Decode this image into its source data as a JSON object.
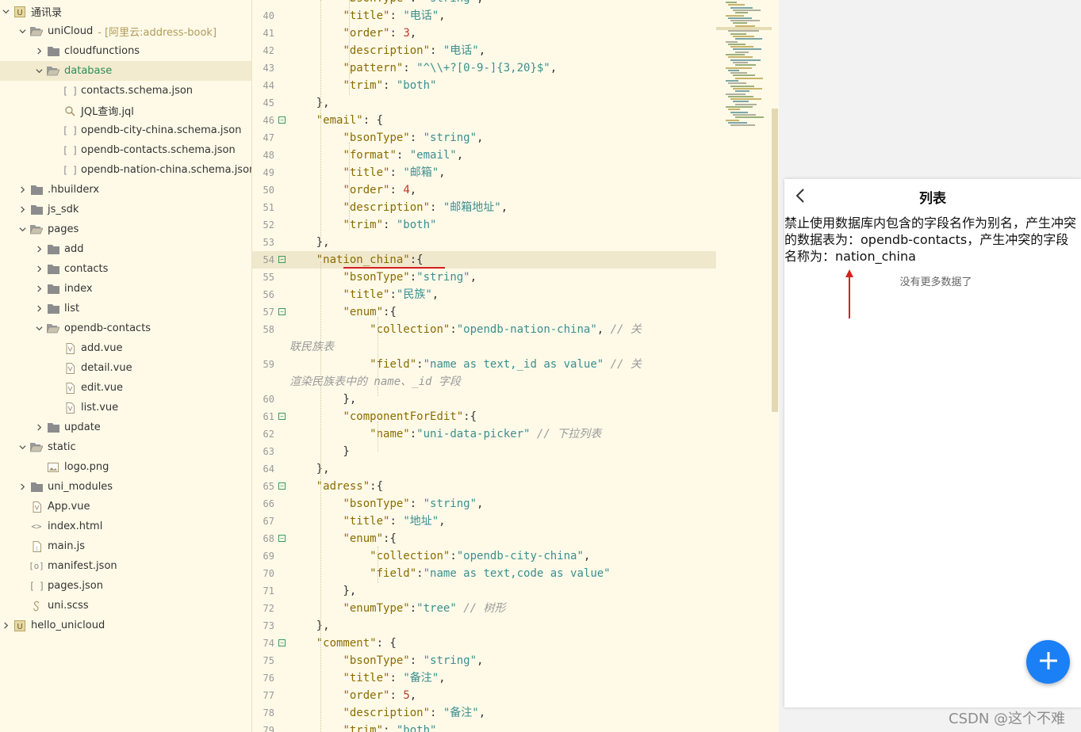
{
  "sidebar": {
    "items": [
      {
        "label": "通讯录",
        "suffix": "",
        "icon": "project-icon",
        "chev": "down",
        "indent": 0
      },
      {
        "label": "uniCloud",
        "suffix": "- [阿里云:address-book]",
        "icon": "folder-open-icon",
        "chev": "down",
        "indent": 1
      },
      {
        "label": "cloudfunctions",
        "suffix": "",
        "icon": "folder-closed-icon",
        "chev": "right",
        "indent": 2
      },
      {
        "label": "database",
        "suffix": "",
        "icon": "folder-open-icon",
        "chev": "down",
        "indent": 2
      },
      {
        "label": "contacts.schema.json",
        "suffix": "",
        "icon": "json-icon",
        "chev": "",
        "indent": 3
      },
      {
        "label": "JQL查询.jql",
        "suffix": "",
        "icon": "jql-icon",
        "chev": "",
        "indent": 3
      },
      {
        "label": "opendb-city-china.schema.json",
        "suffix": "",
        "icon": "json-icon",
        "chev": "",
        "indent": 3
      },
      {
        "label": "opendb-contacts.schema.json",
        "suffix": "",
        "icon": "json-icon",
        "chev": "",
        "indent": 3
      },
      {
        "label": "opendb-nation-china.schema.json",
        "suffix": "",
        "icon": "json-icon",
        "chev": "",
        "indent": 3
      },
      {
        "label": ".hbuilderx",
        "suffix": "",
        "icon": "folder-closed-icon",
        "chev": "right",
        "indent": 1
      },
      {
        "label": "js_sdk",
        "suffix": "",
        "icon": "folder-closed-icon",
        "chev": "right",
        "indent": 1
      },
      {
        "label": "pages",
        "suffix": "",
        "icon": "folder-open-icon",
        "chev": "down",
        "indent": 1
      },
      {
        "label": "add",
        "suffix": "",
        "icon": "folder-closed-icon",
        "chev": "right",
        "indent": 2
      },
      {
        "label": "contacts",
        "suffix": "",
        "icon": "folder-closed-icon",
        "chev": "right",
        "indent": 2
      },
      {
        "label": "index",
        "suffix": "",
        "icon": "folder-closed-icon",
        "chev": "right",
        "indent": 2
      },
      {
        "label": "list",
        "suffix": "",
        "icon": "folder-closed-icon",
        "chev": "right",
        "indent": 2
      },
      {
        "label": "opendb-contacts",
        "suffix": "",
        "icon": "folder-open-icon",
        "chev": "down",
        "indent": 2
      },
      {
        "label": "add.vue",
        "suffix": "",
        "icon": "vue-icon",
        "chev": "",
        "indent": 3
      },
      {
        "label": "detail.vue",
        "suffix": "",
        "icon": "vue-icon",
        "chev": "",
        "indent": 3
      },
      {
        "label": "edit.vue",
        "suffix": "",
        "icon": "vue-icon",
        "chev": "",
        "indent": 3
      },
      {
        "label": "list.vue",
        "suffix": "",
        "icon": "vue-icon",
        "chev": "",
        "indent": 3
      },
      {
        "label": "update",
        "suffix": "",
        "icon": "folder-closed-icon",
        "chev": "right",
        "indent": 2
      },
      {
        "label": "static",
        "suffix": "",
        "icon": "folder-open-icon",
        "chev": "down",
        "indent": 1
      },
      {
        "label": "logo.png",
        "suffix": "",
        "icon": "image-icon",
        "chev": "",
        "indent": 2
      },
      {
        "label": "uni_modules",
        "suffix": "",
        "icon": "folder-closed-icon",
        "chev": "right",
        "indent": 1
      },
      {
        "label": "App.vue",
        "suffix": "",
        "icon": "vue-icon",
        "chev": "",
        "indent": 1
      },
      {
        "label": "index.html",
        "suffix": "",
        "icon": "html-icon",
        "chev": "",
        "indent": 1
      },
      {
        "label": "main.js",
        "suffix": "",
        "icon": "js-icon",
        "chev": "",
        "indent": 1
      },
      {
        "label": "manifest.json",
        "suffix": "",
        "icon": "manifest-icon",
        "chev": "",
        "indent": 1
      },
      {
        "label": "pages.json",
        "suffix": "",
        "icon": "json-icon",
        "chev": "",
        "indent": 1
      },
      {
        "label": "uni.scss",
        "suffix": "",
        "icon": "scss-icon",
        "chev": "",
        "indent": 1
      },
      {
        "label": "hello_unicloud",
        "suffix": "",
        "icon": "project-icon",
        "chev": "right",
        "indent": 0
      }
    ],
    "selected_index": 3
  },
  "editor": {
    "lines": [
      {
        "n": "40",
        "code": "        \"title\": \"电话\","
      },
      {
        "n": "41",
        "code": "        \"order\": 3,"
      },
      {
        "n": "42",
        "code": "        \"description\": \"电话\","
      },
      {
        "n": "43",
        "code": "        \"pattern\": \"^\\\\+?[0-9-]{3,20}$\","
      },
      {
        "n": "44",
        "code": "        \"trim\": \"both\""
      },
      {
        "n": "45",
        "code": "    },"
      },
      {
        "n": "46",
        "code": "    \"email\": {",
        "fold": true
      },
      {
        "n": "47",
        "code": "        \"bsonType\": \"string\","
      },
      {
        "n": "48",
        "code": "        \"format\": \"email\","
      },
      {
        "n": "49",
        "code": "        \"title\": \"邮箱\","
      },
      {
        "n": "50",
        "code": "        \"order\": 4,"
      },
      {
        "n": "51",
        "code": "        \"description\": \"邮箱地址\","
      },
      {
        "n": "52",
        "code": "        \"trim\": \"both\""
      },
      {
        "n": "53",
        "code": "    },"
      },
      {
        "n": "54",
        "code": "    \"nation_china\":{",
        "fold": true,
        "active": true
      },
      {
        "n": "55",
        "code": "        \"bsonType\":\"string\","
      },
      {
        "n": "56",
        "code": "        \"title\":\"民族\","
      },
      {
        "n": "57",
        "code": "        \"enum\":{",
        "fold": true
      },
      {
        "n": "58",
        "code": "            \"collection\":\"opendb-nation-china\", // 关"
      },
      {
        "n": "",
        "code": "联民族表",
        "wrap": true
      },
      {
        "n": "59",
        "code": "            \"field\":\"name as text,_id as value\" // 关"
      },
      {
        "n": "",
        "code": "渲染民族表中的 name、_id 字段",
        "wrap": true
      },
      {
        "n": "60",
        "code": "        },"
      },
      {
        "n": "61",
        "code": "        \"componentForEdit\":{",
        "fold": true
      },
      {
        "n": "62",
        "code": "            \"name\":\"uni-data-picker\" // 下拉列表"
      },
      {
        "n": "63",
        "code": "        }"
      },
      {
        "n": "64",
        "code": "    },"
      },
      {
        "n": "65",
        "code": "    \"adress\":{",
        "fold": true
      },
      {
        "n": "66",
        "code": "        \"bsonType\": \"string\","
      },
      {
        "n": "67",
        "code": "        \"title\": \"地址\","
      },
      {
        "n": "68",
        "code": "        \"enum\":{",
        "fold": true
      },
      {
        "n": "69",
        "code": "            \"collection\":\"opendb-city-china\","
      },
      {
        "n": "70",
        "code": "            \"field\":\"name as text,code as value\""
      },
      {
        "n": "71",
        "code": "        },"
      },
      {
        "n": "72",
        "code": "        \"enumType\":\"tree\" // 树形"
      },
      {
        "n": "73",
        "code": "    },"
      },
      {
        "n": "74",
        "code": "    \"comment\": {",
        "fold": true
      },
      {
        "n": "75",
        "code": "        \"bsonType\": \"string\","
      },
      {
        "n": "76",
        "code": "        \"title\": \"备注\","
      },
      {
        "n": "77",
        "code": "        \"order\": 5,"
      },
      {
        "n": "78",
        "code": "        \"description\": \"备注\","
      },
      {
        "n": "79",
        "code": "        \"trim\": \"both\""
      }
    ],
    "first_line_partial": "        \"bsonType\": \"string\","
  },
  "preview": {
    "title": "列表",
    "error_message": "禁止使用数据库内包含的字段名作为别名，产生冲突的数据表为：opendb-contacts，产生冲突的字段名称为：nation_china",
    "no_more": "没有更多数据了",
    "fab_icon": "plus-icon"
  },
  "watermark": "CSDN @这个不难",
  "colors": {
    "accent": "#1b7ff5",
    "editor_bg": "#fffae8",
    "selected_text": "#2a8d5a",
    "arrow": "#d32020"
  }
}
